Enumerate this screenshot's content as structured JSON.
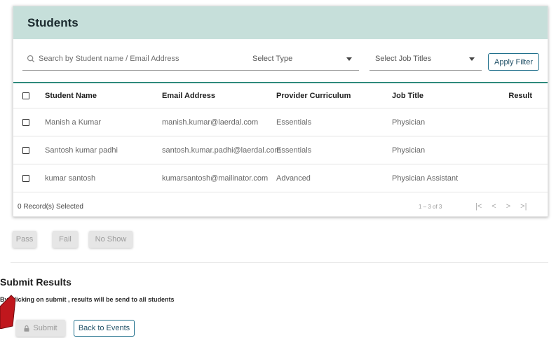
{
  "students_card": {
    "title": "Students",
    "search": {
      "placeholder": "Search by Student name / Email Address",
      "value": ""
    },
    "select_type": {
      "label": "Select Type"
    },
    "select_job": {
      "label": "Select Job Titles"
    },
    "apply_filter_label": "Apply Filter"
  },
  "table": {
    "headers": {
      "name": "Student Name",
      "email": "Email Address",
      "curriculum": "Provider Curriculum",
      "job": "Job Title",
      "result": "Result"
    },
    "rows": [
      {
        "name": "Manish a Kumar",
        "email": "manish.kumar@laerdal.com",
        "curriculum": "Essentials",
        "job": "Physician",
        "result": ""
      },
      {
        "name": "Santosh kumar padhi",
        "email": "santosh.kumar.padhi@laerdal.com",
        "curriculum": "Essentials",
        "job": "Physician",
        "result": ""
      },
      {
        "name": "kumar santosh",
        "email": "kumarsantosh@mailinator.com",
        "curriculum": "Advanced",
        "job": "Physician Assistant",
        "result": ""
      }
    ],
    "footer": {
      "selected": "0 Record(s) Selected",
      "range": "1 – 3 of 3",
      "pager": {
        "first": "|<",
        "prev": "<",
        "next": ">",
        "last": ">|"
      }
    }
  },
  "actions": {
    "pass": "Pass",
    "fail": "Fail",
    "no_show": "No Show"
  },
  "submit_section": {
    "title": "Submit Results",
    "note": "By Clicking on submit , results will be send to all students",
    "submit_label": "Submit",
    "back_label": "Back to Events"
  },
  "colors": {
    "header_bg": "#c6dfda",
    "accent_border": "#2e8a7c",
    "button_outline": "#1f6f8b",
    "pointer_red": "#c0171d"
  },
  "icons": {
    "search": "search-icon",
    "caret": "chevron-down-icon",
    "lock": "lock-icon",
    "pointer": "arrow-pointer-icon"
  }
}
